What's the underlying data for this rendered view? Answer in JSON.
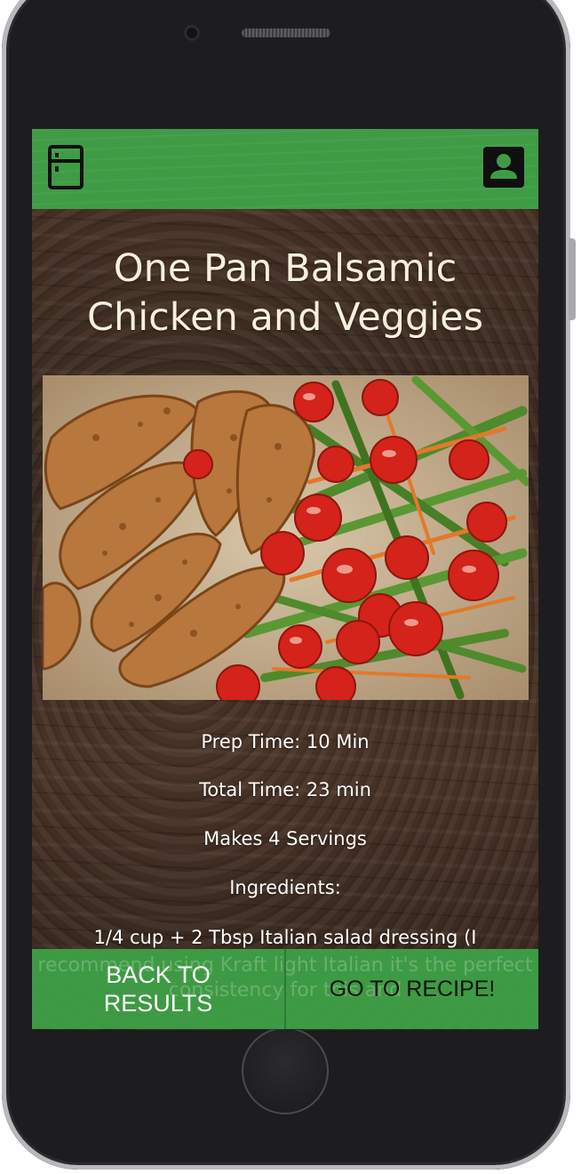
{
  "recipe": {
    "title": "One Pan Balsamic Chicken and Veggies",
    "prep_time": "Prep Time: 10 Min",
    "total_time": "Total Time: 23 min",
    "servings": "Makes 4 Servings",
    "ingredients_heading": "Ingredients:",
    "ingredient_line_1": "1/4 cup + 2 Tbsp Italian salad dressing (I",
    "ingredient_line_2": "recommend using Kraft light Italian it's the perfect",
    "ingredient_line_3": "consistency for this and"
  },
  "topbar": {
    "fridge_icon": "fridge-icon",
    "profile_icon": "profile-icon"
  },
  "bottombar": {
    "back_label": "BACK TO RESULTS",
    "go_label": "GO TO RECIPE!"
  },
  "colors": {
    "bar_green": "#3f9c45",
    "title_cream": "#f7f0dc"
  }
}
